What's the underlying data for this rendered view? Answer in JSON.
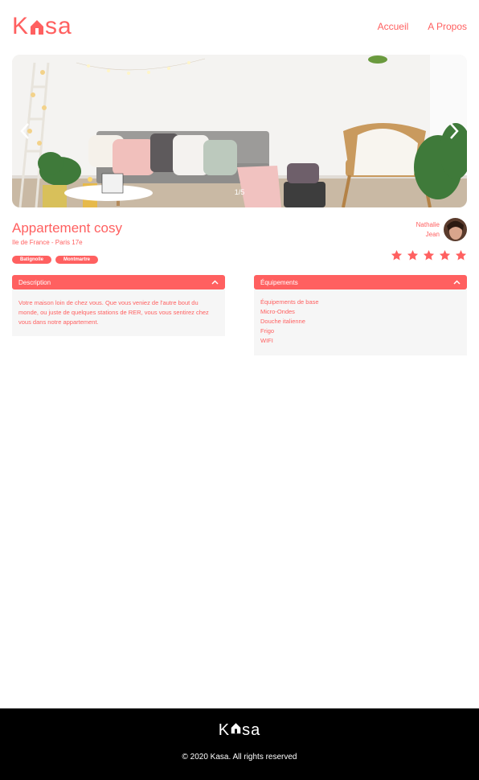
{
  "brand": {
    "logo_text_before": "K",
    "logo_text_after": "sa",
    "color": "#FF6060"
  },
  "nav": {
    "home": "Accueil",
    "about": "A Propos"
  },
  "carousel": {
    "counter": "1/5"
  },
  "listing": {
    "title": "Appartement cosy",
    "location": "Ile de France - Paris 17e",
    "tags": [
      "Batignolle",
      "Montmartre"
    ],
    "host": {
      "first_name": "Nathalie",
      "last_name": "Jean"
    },
    "rating": 5,
    "rating_max": 5
  },
  "description": {
    "label": "Description",
    "text": "Votre maison loin de chez vous. Que vous veniez de l'autre bout du monde, ou juste de quelques stations de RER, vous vous sentirez chez vous dans notre appartement."
  },
  "equipments": {
    "label": "Équipements",
    "items": [
      "Équipements de base",
      "Micro-Ondes",
      "Douche italienne",
      "Frigo",
      "WIFI"
    ]
  },
  "footer": {
    "copyright": "© 2020 Kasa. All rights reserved"
  },
  "icons": {
    "chevron": "chevron-up-icon",
    "star": "star-icon"
  }
}
